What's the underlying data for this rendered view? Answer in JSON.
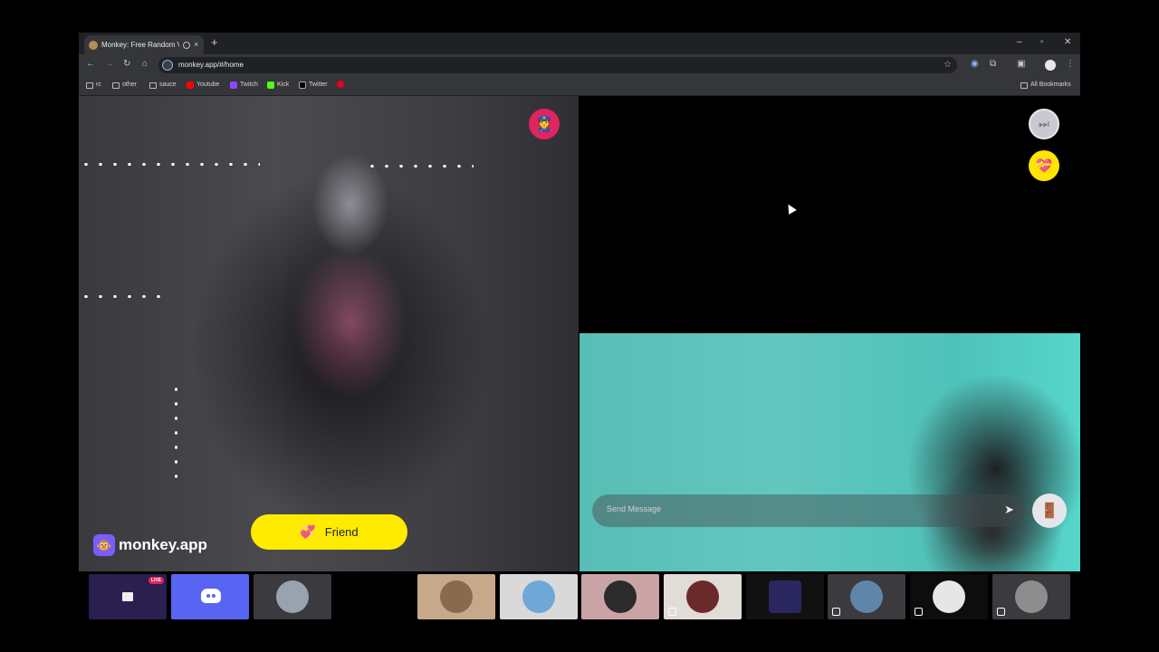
{
  "browser": {
    "tab_title": "Monkey: Free Random Video Chat",
    "tab_close": "×",
    "new_tab": "+",
    "url": "monkey.app/#/home",
    "window_controls": {
      "minimize": "–",
      "maximize": "▫",
      "close": "✕"
    },
    "nav": {
      "back": "←",
      "forward": "→",
      "reload": "↻",
      "home": "⌂",
      "star": "☆"
    },
    "bookmarks": [
      {
        "label": "rc",
        "type": "folder"
      },
      {
        "label": "other",
        "type": "folder"
      },
      {
        "label": "sauce",
        "type": "folder"
      },
      {
        "label": "Youtube",
        "type": "site",
        "color": "#ff0000"
      },
      {
        "label": "Twitch",
        "type": "site",
        "color": "#9146ff"
      },
      {
        "label": "Kick",
        "type": "site",
        "color": "#53fc18"
      },
      {
        "label": "Twitter",
        "type": "site",
        "color": "#000000"
      },
      {
        "label": "",
        "type": "site",
        "color": "#e60023"
      }
    ],
    "all_bookmarks": "All Bookmarks"
  },
  "app": {
    "logo_text": "monkey.app",
    "logo_icon": "🐵",
    "friend_button": "Friend",
    "friend_icon": "💞",
    "police_icon": "👮",
    "skip_icon": "⏭",
    "gift_icon": "💝",
    "chat_placeholder": "Send Message",
    "send_icon": "➤",
    "exit_icon": "🚪",
    "colors": {
      "accent_yellow": "#ffeb00",
      "brand_purple": "#7b5cff",
      "police_pink": "#e0245e"
    }
  },
  "taskbar": {
    "live_label": "LIVE"
  }
}
